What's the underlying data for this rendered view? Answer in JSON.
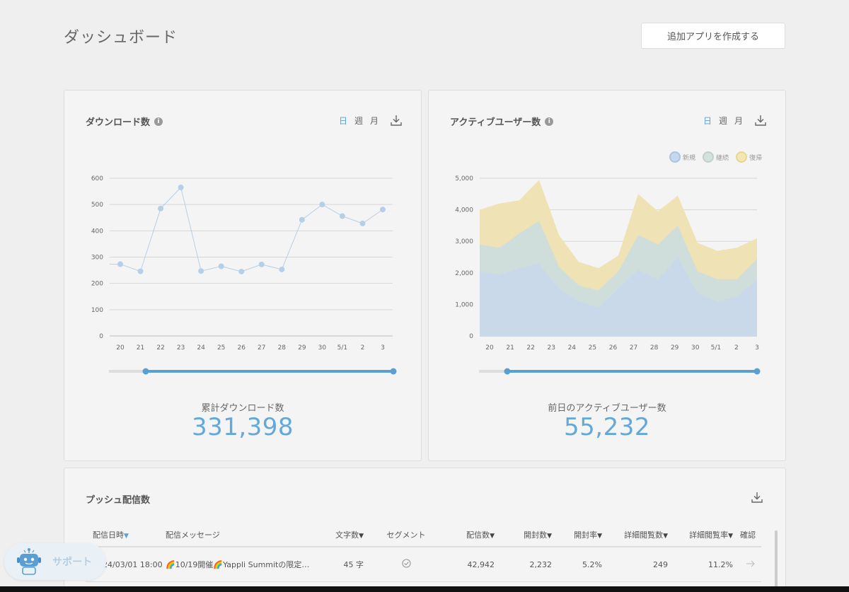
{
  "header": {
    "title": "ダッシュボード",
    "create_button": "追加アプリを作成する"
  },
  "downloads_card": {
    "title": "ダウンロード数",
    "info": "i",
    "periods": [
      "日",
      "週",
      "月"
    ],
    "active_period": "日",
    "total_label": "累計ダウンロード数",
    "total_value": "331,398"
  },
  "active_card": {
    "title": "アクティブユーザー数",
    "info": "i",
    "periods": [
      "日",
      "週",
      "月"
    ],
    "active_period": "日",
    "legend": [
      "新規",
      "継続",
      "復帰"
    ],
    "total_label": "前日のアクティブユーザー数",
    "total_value": "55,232"
  },
  "push_card": {
    "title": "プッシュ配信数",
    "columns": [
      "配信日時",
      "配信メッセージ",
      "文字数",
      "セグメント",
      "配信数",
      "開封数",
      "開封率",
      "詳細閲覧数",
      "詳細閲覧率",
      "確認"
    ],
    "rows": [
      {
        "date": "24/03/01 18:00",
        "message": "🌈10/19開催🌈Yappli Summitの限定…",
        "chars": "45 字",
        "sent": "42,942",
        "opened": "2,232",
        "open_rate": "5.2%",
        "detail_views": "249",
        "detail_rate": "11.2%"
      }
    ]
  },
  "support": {
    "label": "サポート"
  },
  "chart_data": [
    {
      "type": "line",
      "categories": [
        "20",
        "21",
        "22",
        "23",
        "24",
        "25",
        "26",
        "27",
        "28",
        "29",
        "30",
        "5/1",
        "2",
        "3"
      ],
      "series": [
        {
          "values": [
            273,
            246,
            485,
            565,
            247,
            265,
            245,
            272,
            253,
            442,
            500,
            456,
            428,
            481
          ]
        }
      ],
      "ylim": [
        0,
        600
      ],
      "yticks": [
        0,
        100,
        200,
        300,
        400,
        500,
        600
      ],
      "colors": [
        "#b6cfe8"
      ]
    },
    {
      "type": "area",
      "categories": [
        "20",
        "21",
        "22",
        "23",
        "24",
        "25",
        "26",
        "27",
        "28",
        "29",
        "30",
        "5/1",
        "2",
        "3"
      ],
      "series": [
        {
          "name": "新規",
          "values": [
            2050,
            1950,
            2150,
            2300,
            1500,
            1100,
            900,
            1500,
            2100,
            1800,
            2500,
            1350,
            1100,
            1250,
            1800
          ]
        },
        {
          "name": "継続",
          "values": [
            2900,
            2800,
            3250,
            3650,
            2200,
            1600,
            1450,
            2050,
            3200,
            2900,
            3500,
            2050,
            1800,
            1800,
            2450
          ]
        },
        {
          "name": "復帰",
          "values": [
            4000,
            4200,
            4300,
            4950,
            3200,
            2350,
            2150,
            2550,
            4500,
            3950,
            4450,
            2950,
            2700,
            2800,
            3100
          ]
        }
      ],
      "ylim": [
        0,
        5000
      ],
      "yticks": [
        "0",
        "1,000",
        "2,000",
        "3,000",
        "4,000",
        "5,000"
      ],
      "colors": [
        "#c9d9ea",
        "#d0dedb",
        "#efe2b4"
      ],
      "legend_position": "top-right"
    }
  ]
}
